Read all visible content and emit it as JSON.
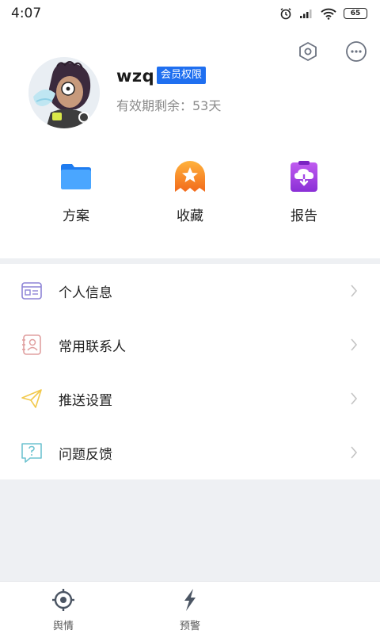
{
  "status_bar": {
    "time": "4:07",
    "battery": "65"
  },
  "header": {
    "settings_icon": "hexagon-nut-icon",
    "message_icon": "chat-bubble-icon"
  },
  "profile": {
    "username": "wzq",
    "badge": "会员权限",
    "validity": "有效期剩余：53天"
  },
  "quick_actions": [
    {
      "label": "方案",
      "icon": "folder-icon",
      "color": "#2f8cf5"
    },
    {
      "label": "收藏",
      "icon": "star-bookmark-icon",
      "color": "#f7901e"
    },
    {
      "label": "报告",
      "icon": "cloud-download-icon",
      "color": "#9b3fe0"
    }
  ],
  "menu": {
    "items": [
      {
        "label": "个人信息",
        "icon": "id-card-icon",
        "color": "#8d84d6"
      },
      {
        "label": "常用联系人",
        "icon": "contacts-book-icon",
        "color": "#e0a0a0"
      },
      {
        "label": "推送设置",
        "icon": "paper-plane-icon",
        "color": "#f2c94c"
      },
      {
        "label": "问题反馈",
        "icon": "question-bubble-icon",
        "color": "#6fc3d0"
      }
    ]
  },
  "tabs": [
    {
      "label": "舆情",
      "icon": "target-icon"
    },
    {
      "label": "预警",
      "icon": "lightning-icon"
    }
  ]
}
